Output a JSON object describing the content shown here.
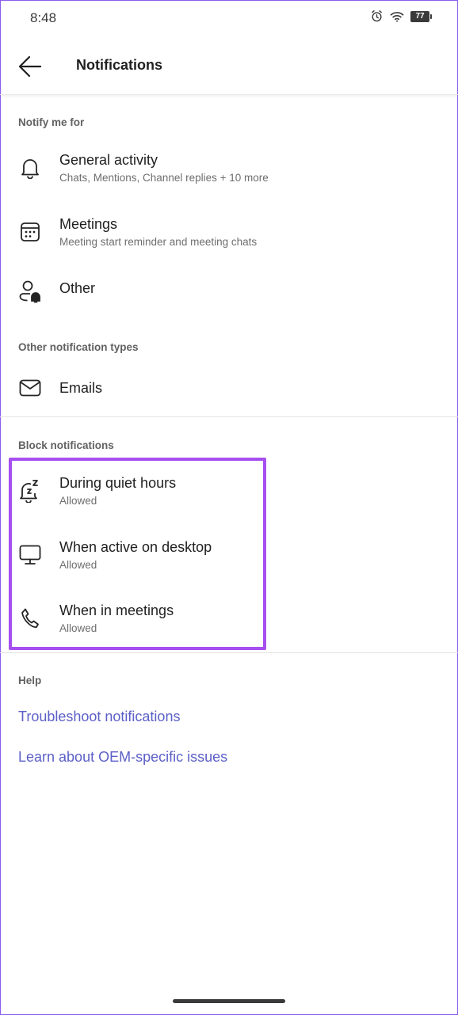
{
  "status_bar": {
    "time": "8:48",
    "icons": [
      "alarm-icon",
      "wifi-icon",
      "battery-icon"
    ],
    "battery_level": "77"
  },
  "app_bar": {
    "back_icon": "arrow-left-icon",
    "title": "Notifications"
  },
  "sections": {
    "notify_me_for": {
      "header": "Notify me for",
      "items": [
        {
          "icon": "bell-icon",
          "title": "General activity",
          "subtitle": "Chats, Mentions, Channel replies + 10 more"
        },
        {
          "icon": "calendar-icon",
          "title": "Meetings",
          "subtitle": "Meeting start reminder and meeting chats"
        },
        {
          "icon": "person-bell-icon",
          "title": "Other"
        }
      ]
    },
    "other_types": {
      "header": "Other notification types",
      "items": [
        {
          "icon": "mail-icon",
          "title": "Emails"
        }
      ]
    },
    "block": {
      "header": "Block notifications",
      "items": [
        {
          "icon": "snooze-bell-icon",
          "title": "During quiet hours",
          "subtitle": "Allowed"
        },
        {
          "icon": "desktop-icon",
          "title": "When active on desktop",
          "subtitle": "Allowed"
        },
        {
          "icon": "phone-icon",
          "title": "When in meetings",
          "subtitle": "Allowed"
        }
      ]
    },
    "help": {
      "header": "Help",
      "links": [
        "Troubleshoot notifications",
        "Learn about OEM-specific issues"
      ]
    }
  },
  "colors": {
    "link": "#5b5fc7",
    "highlight": "#a64ff0",
    "text_primary": "#1f1f1f",
    "text_secondary": "#6e6e6e"
  }
}
